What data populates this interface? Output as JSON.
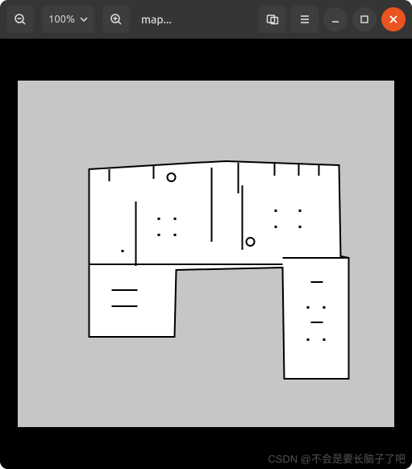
{
  "toolbar": {
    "zoom_out_icon": "zoom-out",
    "zoom_level": "100%",
    "zoom_in_icon": "zoom-in",
    "title": "map...",
    "gallery_icon": "gallery",
    "menu_icon": "menu",
    "minimize_icon": "minimize",
    "maximize_icon": "maximize",
    "close_icon": "close"
  },
  "watermark": "CSDN @不会是要长脑子了吧",
  "map": {
    "background": "#c6c6c6",
    "free_color": "#ffffff",
    "wall_color": "#000000"
  }
}
